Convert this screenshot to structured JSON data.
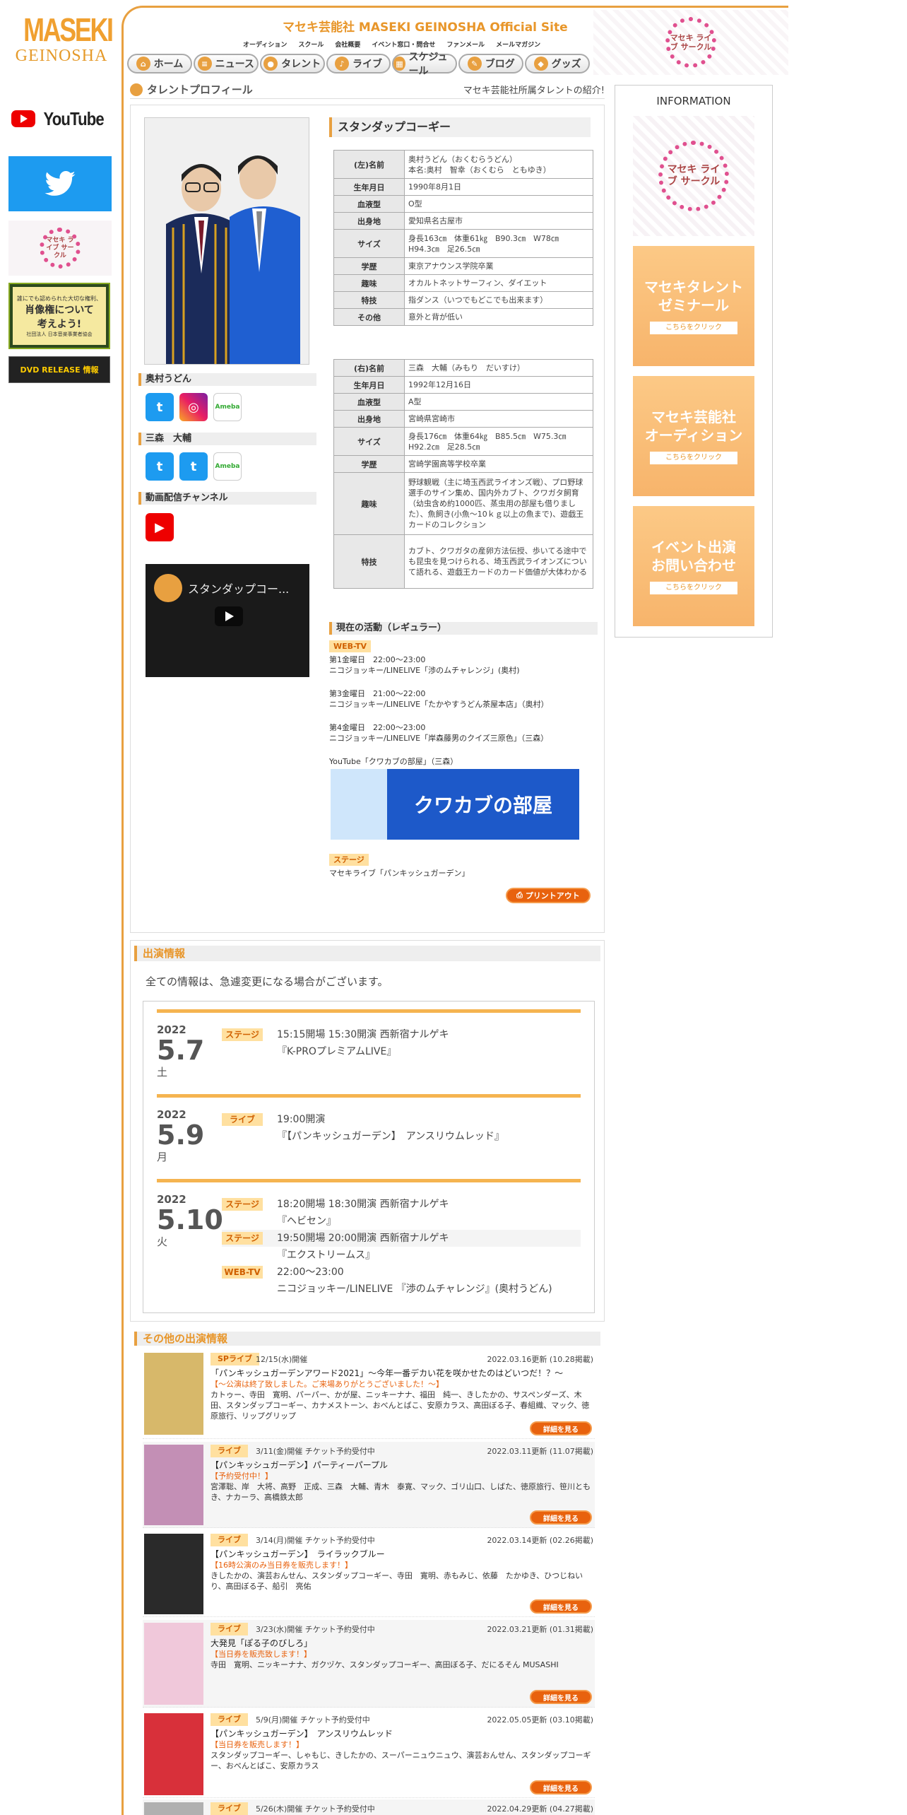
{
  "left": {
    "logo_line1": "MASEKI",
    "logo_line2": "GEINOSHA",
    "youtube": "YouTube",
    "rights_line1": "誰にでも認められた大切な権利、",
    "rights_line2": "肖像権について",
    "rights_line3": "考えよう!",
    "rights_org": "社団法人 日本音楽事業者協会",
    "dvd": "DVD RELEASE 情報"
  },
  "header": {
    "site_title": "マセキ芸能社 MASEKI GEINOSHA Official Site",
    "submenu": [
      "オーディション",
      "スクール",
      "会社概要",
      "イベント窓口・問合せ",
      "ファンメール",
      "メールマガジン"
    ],
    "nav": [
      "ホーム",
      "ニュース",
      "タレント",
      "ライブ",
      "スケジュール",
      "ブログ",
      "グッズ"
    ],
    "livecircle": "マセキ ライブ サークル"
  },
  "profile_header": {
    "title": "タレントプロフィール",
    "subtitle": "マセキ芸能社所属タレントの紹介!"
  },
  "unit": {
    "name": "スタンダップコーギー"
  },
  "members": [
    {
      "section": "奥村うどん",
      "rows": [
        [
          "(左)名前",
          "奥村うどん（おくむらうどん）\n本名:奥村　智幸（おくむら　ともゆき）"
        ],
        [
          "生年月日",
          "1990年8月1日"
        ],
        [
          "血液型",
          "O型"
        ],
        [
          "出身地",
          "愛知県名古屋市"
        ],
        [
          "サイズ",
          "身長163㎝　体重61㎏　B90.3㎝　W78㎝\nH94.3㎝　足26.5㎝"
        ],
        [
          "学歴",
          "東京アナウンス学院卒業"
        ],
        [
          "趣味",
          "オカルトネットサーフィン、ダイエット"
        ],
        [
          "特技",
          "指ダンス（いつでもどこでも出来ます）"
        ],
        [
          "その他",
          "意外と背が低い"
        ]
      ]
    },
    {
      "section": "三森　大輔",
      "rows": [
        [
          "(右)名前",
          "三森　大輔（みもり　だいすけ）"
        ],
        [
          "生年月日",
          "1992年12月16日"
        ],
        [
          "血液型",
          "A型"
        ],
        [
          "出身地",
          "宮崎県宮崎市"
        ],
        [
          "サイズ",
          "身長176㎝　体重64㎏　B85.5㎝　W75.3㎝\nH92.2㎝　足28.5㎝"
        ],
        [
          "学歴",
          "宮崎学園高等学校卒業"
        ],
        [
          "趣味",
          "野球観戦（主に埼玉西武ライオンズ戦）、プロ野球選手のサイン集め、国内外カブト、クワガタ飼育（幼虫含め約1000匹、蒸虫用の部屋も借りました）、魚飼き(小魚～10ｋｇ以上の魚まで)、遊戯王カードのコレクション"
        ],
        [
          "特技",
          "カブト、クワガタの産卵方法伝授、歩いてる途中でも昆虫を見つけられる、埼玉西武ライオンズについて語れる、遊戯王カードのカード価値が大体わかる"
        ]
      ]
    }
  ],
  "channel_section": "動画配信チャンネル",
  "video_title": "スタンダップコー...",
  "activity": {
    "header": "現在の活動（レギュラー）",
    "webtv": "WEB-TV",
    "items": [
      [
        "第1金曜日　22:00～23:00",
        "ニコジョッキー/LINELIVE「渉のムチャレンジ」(奥村)"
      ],
      [
        "第3金曜日　21:00～22:00",
        "ニコジョッキー/LINELIVE「たかやすうどん茶屋本店」（奥村）"
      ],
      [
        "第4金曜日　22:00～23:00",
        "ニコジョッキー/LINELIVE「岸森藤男のクイズ三原色」（三森）"
      ]
    ],
    "youtube": "YouTube「クワカブの部屋」（三森）",
    "banner": "クワカブの部屋",
    "stage": "ステージ",
    "stage_item": "マセキライブ「パンキッシュガーデン」",
    "print": "プリントアウト"
  },
  "appearances": {
    "header": "出演情報",
    "note": "全ての情報は、急遽変更になる場合がございます。",
    "days": [
      {
        "year": "2022",
        "date": "5.7",
        "weekday": "土",
        "items": [
          {
            "tag": "ステージ",
            "line1": "15:15開場 15:30開演 西新宿ナルゲキ",
            "line2": "『K-PROプレミアムLIVE』"
          }
        ]
      },
      {
        "year": "2022",
        "date": "5.9",
        "weekday": "月",
        "items": [
          {
            "tag": "ライブ",
            "line1": "19:00開演",
            "line2": "『【パンキッシュガーデン】　アンスリウムレッド』"
          }
        ]
      },
      {
        "year": "2022",
        "date": "5.10",
        "weekday": "火",
        "items": [
          {
            "tag": "ステージ",
            "line1": "18:20開場 18:30開演 西新宿ナルゲキ",
            "line2": "『ヘビセン』"
          },
          {
            "tag": "ステージ",
            "line1": "19:50開場 20:00開演 西新宿ナルゲキ",
            "line2": "『エクストリームス』"
          },
          {
            "tag": "WEB-TV",
            "line1": "22:00～23:00",
            "line2": "ニコジョッキー/LINELIVE 『渉のムチャレンジ』(奥村うどん)"
          }
        ]
      }
    ]
  },
  "others": {
    "header": "その他の出演情報",
    "detail": "詳細を見る",
    "items": [
      {
        "cat": "SPライブ",
        "when": "12/15(水)開催",
        "updated": "2022.03.16更新 (10.28掲載)",
        "title": "「パンキッシュガーデンアワード2021」〜今年一番デカい花を咲かせたのはどいつだ！？〜",
        "note": "【〜公演は終了致しました。ご来場ありがとうございました！〜】",
        "members": "カトゥー、寺田　寛明、パーパー、かが屋、ニッキーナナ、福田　純一、きしたかの、サスペンダーズ、木田、スタンダップコーギー、カナメストーン、おべんとばこ、安原カラス、高田ぼる子、春組織、マック、徳原旅行、リップグリップ"
      },
      {
        "cat": "ライブ",
        "when": "3/11(金)開催 チケット予約受付中",
        "updated": "2022.03.11更新 (11.07掲載)",
        "title": "【パンキッシュガーデン】パーティーパープル",
        "note": "【予約受付中！】",
        "members": "宮澤聡、岸　大将、高野　正成、三森　大輔、青木　泰寛、マック、ゴリ山口、しばた、徳原旅行、笹川ともき、ナカーラ、高橋鉄太郎"
      },
      {
        "cat": "ライブ",
        "when": "3/14(月)開催 チケット予約受付中",
        "updated": "2022.03.14更新 (02.26掲載)",
        "title": "【パンキッシュガーデン】　ライラックブルー",
        "note": "【16時公演のみ当日券を販売します！】",
        "members": "きしたかの、演芸おんせん、スタンダップコーギー、寺田　寛明、赤もみじ、依藤　たかゆき、ひつじねいり、高田ぼる子、船引　亮佑"
      },
      {
        "cat": "ライブ",
        "when": "3/23(水)開催 チケット予約受付中",
        "updated": "2022.03.21更新 (01.31掲載)",
        "title": "大発見「ぽる子のびしろ」",
        "note": "【当日券を販売致します！】",
        "members": "寺田　寛明、ニッキーナナ、ガクヅケ、スタンダップコーギー、高田ぼる子、だにるそん MUSASHI"
      },
      {
        "cat": "ライブ",
        "when": "5/9(月)開催 チケット予約受付中",
        "updated": "2022.05.05更新 (03.10掲載)",
        "title": "【パンキッシュガーデン】　アンスリウムレッド",
        "note": "【当日券を販売します！】",
        "members": "スタンダップコーギー、しゃもじ、きしたかの、スーパーニュウニュウ、演芸おんせん、スタンダップコーギー、おべんとばこ、安原カラス"
      },
      {
        "cat": "ライブ",
        "when": "5/26(木)開催 チケット予約受付中",
        "updated": "2022.04.29更新 (04.27掲載)",
        "title": "",
        "note": "",
        "members": ""
      }
    ]
  },
  "info": {
    "title": "INFORMATION",
    "livecircle": "マセキ ライブ サークル",
    "banners": [
      [
        "マセキタレント",
        "ゼミナール"
      ],
      [
        "マセキ芸能社",
        "オーディション"
      ],
      [
        "イベント出演",
        "お問い合わせ"
      ]
    ],
    "click": "こちらをクリック"
  }
}
